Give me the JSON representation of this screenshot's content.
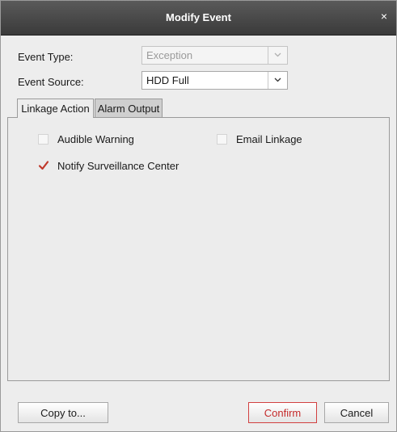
{
  "dialog": {
    "title": "Modify Event",
    "close_glyph": "×"
  },
  "fields": {
    "event_type_label": "Event Type:",
    "event_type_value": "Exception",
    "event_source_label": "Event Source:",
    "event_source_value": "HDD Full"
  },
  "tabs": [
    {
      "label": "Linkage Action",
      "active": true
    },
    {
      "label": "Alarm Output",
      "active": false
    }
  ],
  "linkage_options": [
    {
      "label": "Audible Warning",
      "checked": false
    },
    {
      "label": "Email Linkage",
      "checked": false
    },
    {
      "label": "Notify Surveillance Center",
      "checked": true
    }
  ],
  "buttons": {
    "copy_to": "Copy to...",
    "confirm": "Confirm",
    "cancel": "Cancel"
  },
  "colors": {
    "titlebar": "#3a3a3a",
    "confirm_accent": "#d24040",
    "checkmark": "#c0392b"
  },
  "icons": {
    "close": "close-icon",
    "dropdown": "chevron-down-icon",
    "check": "checkmark-icon"
  }
}
